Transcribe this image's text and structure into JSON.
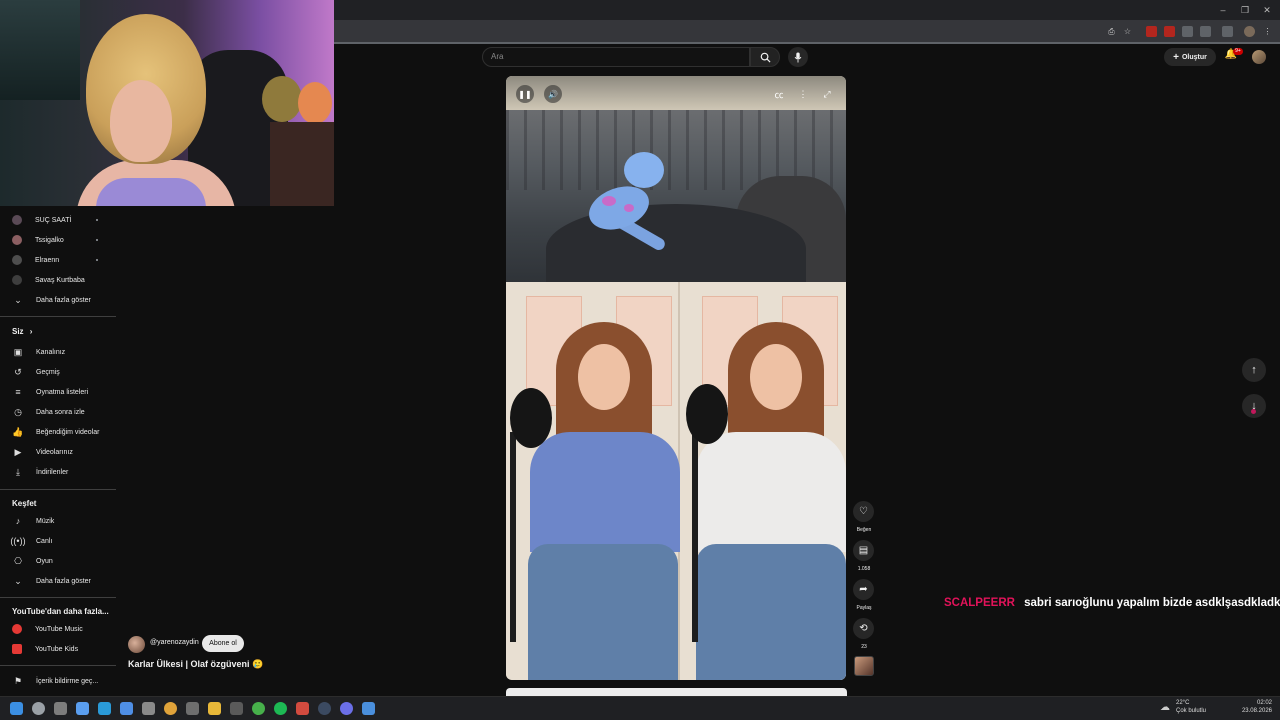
{
  "search": {
    "placeholder": "Ara"
  },
  "header": {
    "create_label": "Oluştur",
    "notification_badge": "9+"
  },
  "sidebar": {
    "subscriptions": [
      {
        "label": "SUÇ SAATİ",
        "avatar_color": "#5a4a56",
        "has_dot": true
      },
      {
        "label": "Tssigalko",
        "avatar_color": "#8c5f62",
        "has_dot": true
      },
      {
        "label": "Elraenn",
        "avatar_color": "#4e4e4e",
        "has_dot": true
      },
      {
        "label": "Savaş Kurtbaba",
        "avatar_color": "#3e3e3e",
        "has_dot": false
      }
    ],
    "show_more_subs": "Daha fazla göster",
    "you_heading": "Siz",
    "you_items": [
      {
        "label": "Kanalınız",
        "icon": "channel-icon"
      },
      {
        "label": "Geçmiş",
        "icon": "history-icon"
      },
      {
        "label": "Oynatma listeleri",
        "icon": "playlists-icon"
      },
      {
        "label": "Daha sonra izle",
        "icon": "watch-later-icon"
      },
      {
        "label": "Beğendiğim videolar",
        "icon": "liked-videos-icon"
      },
      {
        "label": "Videolarınız",
        "icon": "your-videos-icon"
      },
      {
        "label": "İndirilenler",
        "icon": "downloads-icon"
      }
    ],
    "explore_heading": "Keşfet",
    "explore_items": [
      {
        "label": "Müzik",
        "icon": "music-icon"
      },
      {
        "label": "Canlı",
        "icon": "live-icon"
      },
      {
        "label": "Oyun",
        "icon": "gaming-icon"
      }
    ],
    "show_more_explore": "Daha fazla göster",
    "more_from_heading": "YouTube'dan daha fazla...",
    "more_from_items": [
      {
        "label": "YouTube Music",
        "color": "#e53935"
      },
      {
        "label": "YouTube Kids",
        "color": "#e53935"
      }
    ],
    "report_label": "İçerik bildirme geç..."
  },
  "short": {
    "channel_handle": "@yarenozaydin",
    "subscribe_label": "Abone ol",
    "title": "Karlar Ülkesi | Olaf özgüveni 🥲"
  },
  "actions": {
    "like_label": "Beğen",
    "comments_count": "1.058",
    "share_label": "Paylaş",
    "remix_count": "23"
  },
  "chat": {
    "username": "SCALPEERR",
    "message": "sabri sarıoğlunu yapalım bizde asdklşasdkladk",
    "username_color": "#e2135a"
  },
  "taskbar": {
    "temperature": "22°C",
    "condition": "Çok bulutlu",
    "time": "02:02",
    "date": "23.08.2026",
    "apps": [
      {
        "name": "windows-start-icon",
        "color": "#3b8fe3"
      },
      {
        "name": "taskbar-search-icon",
        "color": "#9aa0a6"
      },
      {
        "name": "task-view-icon",
        "color": "#7d7d7d"
      },
      {
        "name": "widgets-icon",
        "color": "#5a9ef0"
      },
      {
        "name": "edge-icon",
        "color": "#2a9ad8"
      },
      {
        "name": "store-icon",
        "color": "#4f8fe6"
      },
      {
        "name": "settings-icon",
        "color": "#8a8a8a"
      },
      {
        "name": "chrome-icon",
        "color": "#e0a33a"
      },
      {
        "name": "camera-icon",
        "color": "#6e6e6e"
      },
      {
        "name": "file-explorer-icon",
        "color": "#e8b839"
      },
      {
        "name": "obs-icon",
        "color": "#5a5a5a"
      },
      {
        "name": "xbox-icon",
        "color": "#47b04b"
      },
      {
        "name": "spotify-icon",
        "color": "#1db954"
      },
      {
        "name": "recorder-icon",
        "color": "#d24b3f"
      },
      {
        "name": "steam-icon",
        "color": "#3b4a61"
      },
      {
        "name": "discord-icon",
        "color": "#6b6fe8"
      },
      {
        "name": "app-icon",
        "color": "#4a8fdc"
      }
    ]
  },
  "colors": {
    "accent_red": "#ff0000",
    "background": "#0f0f0f"
  }
}
